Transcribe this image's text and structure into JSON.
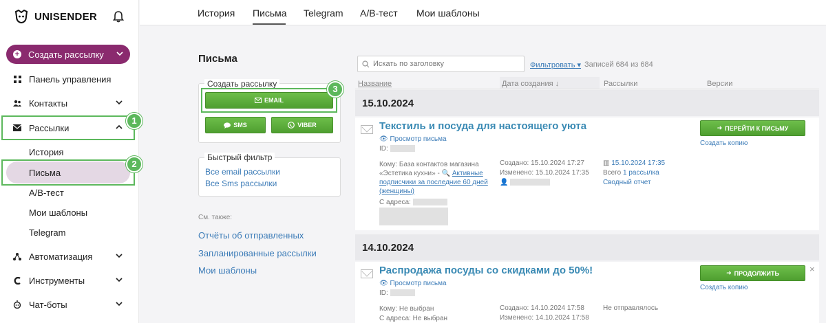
{
  "brand": {
    "name": "UNISENDER"
  },
  "sidebar": {
    "create_label": "Создать рассылку",
    "items": [
      {
        "label": "Панель управления",
        "icon": "dashboard-icon"
      },
      {
        "label": "Контакты",
        "icon": "contacts-icon"
      },
      {
        "label": "Рассылки",
        "icon": "mail-icon"
      },
      {
        "label": "Автоматизация",
        "icon": "automation-icon"
      },
      {
        "label": "Инструменты",
        "icon": "tools-icon"
      },
      {
        "label": "Чат-боты",
        "icon": "chatbot-icon"
      }
    ],
    "sub_items": [
      {
        "label": "История"
      },
      {
        "label": "Письма"
      },
      {
        "label": "A/B-тест"
      },
      {
        "label": "Мои шаблоны"
      },
      {
        "label": "Telegram"
      }
    ]
  },
  "badges": [
    "1",
    "2",
    "3"
  ],
  "tabs": [
    {
      "label": "История"
    },
    {
      "label": "Письма"
    },
    {
      "label": "Telegram"
    },
    {
      "label": "A/B-тест"
    },
    {
      "label": "Мои шаблоны"
    }
  ],
  "page": {
    "title": "Письма",
    "create_box": {
      "legend": "Создать рассылку",
      "email": "EMAIL",
      "sms": "SMS",
      "viber": "VIBER"
    },
    "filter_box": {
      "legend": "Быстрый фильтр",
      "links": [
        "Все email рассылки",
        "Все Sms рассылки"
      ]
    },
    "see_also": {
      "label": "См. также:",
      "links": [
        "Отчёты об отправленных",
        "Запланированные рассылки",
        "Мои шаблоны"
      ]
    }
  },
  "list": {
    "search_placeholder": "Искать по заголовку",
    "filter_label": "Фильтровать",
    "records": "Записей 684 из 684",
    "columns": [
      "Название",
      "Дата создания ↓",
      "Рассылки",
      "Версии"
    ],
    "groups": [
      {
        "date": "15.10.2024",
        "title": "Текстиль и посуда для настоящего уюта",
        "preview": "Просмотр письма",
        "id_label": "ID:",
        "to_prefix": "Кому: База контактов магазина «Эстетика кухни» -",
        "to_segment": "Активные подписчики за последние 60 дней (женщины)",
        "from_label": "С адреса:",
        "created": "Создано: 15.10.2024 17:27",
        "modified": "Изменено: 15.10.2024 17:35",
        "sent_date": "15.10.2024 17:35",
        "sent_total_prefix": "Всего",
        "sent_total_link": "1 рассылка",
        "report": "Сводный отчет",
        "action": "ПЕРЕЙТИ К ПИСЬМУ",
        "copy": "Создать копию"
      },
      {
        "date": "14.10.2024",
        "title": "Распродажа посуды со скидками до 50%!",
        "preview": "Просмотр письма",
        "id_label": "ID:",
        "to_line": "Кому: Не выбран",
        "from_line": "С адреса: Не выбран",
        "created": "Создано: 14.10.2024 17:58",
        "modified": "Изменено: 14.10.2024 17:58",
        "status": "Не отправлялось",
        "action": "ПРОДОЛЖИТЬ",
        "copy": "Создать копию",
        "close": "×"
      }
    ]
  },
  "colors": {
    "accent": "#8a2a6e",
    "green": "#5cb85c",
    "link": "#3b7bb7",
    "title_link": "#3a8ab4"
  }
}
